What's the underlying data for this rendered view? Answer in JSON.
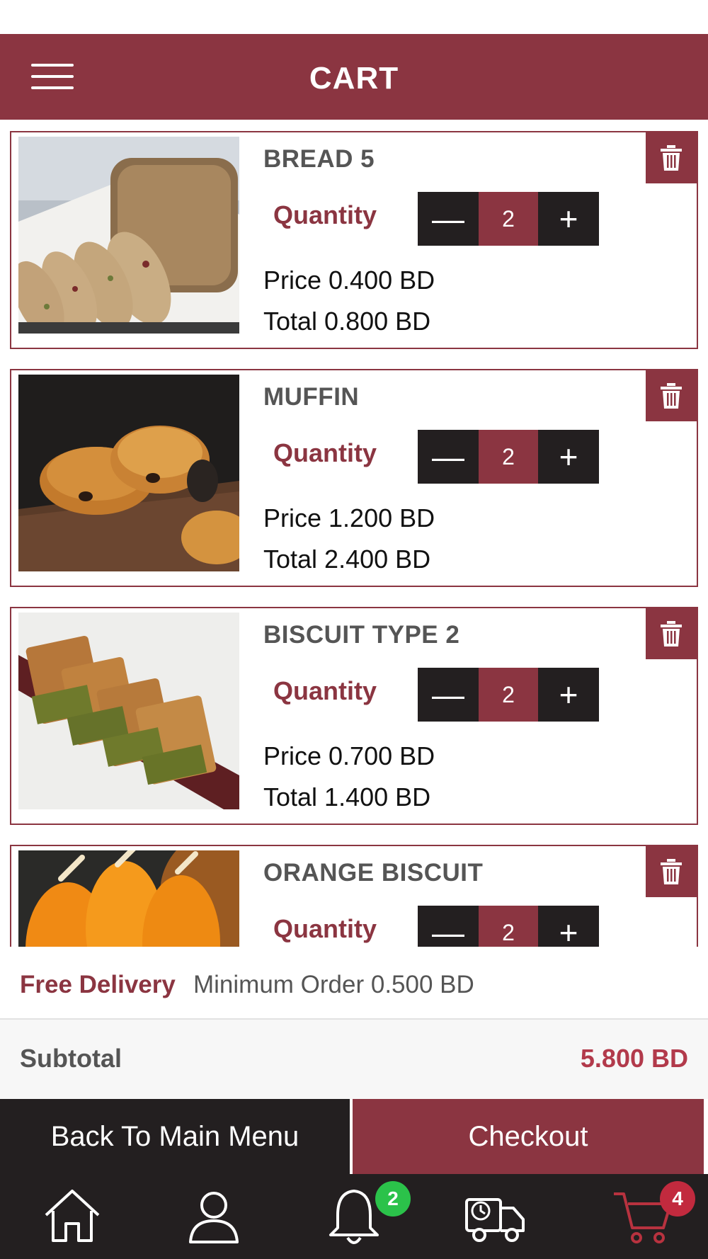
{
  "header": {
    "title": "CART"
  },
  "icons": {
    "menu": "hamburger-menu-icon",
    "delete": "trash-icon",
    "minus": "minus-icon",
    "plus": "plus-icon"
  },
  "colors": {
    "brand": "#8b3541",
    "dark": "#231f20",
    "subtotal_value": "#b23a4b",
    "badge_green": "#2bc24a",
    "badge_red": "#c22a3e"
  },
  "cart": {
    "items": [
      {
        "name": "BREAD 5",
        "quantity_label": "Quantity",
        "quantity": "2",
        "minus": "—",
        "plus": "+",
        "price": "Price 0.400 BD",
        "total": "Total 0.800 BD"
      },
      {
        "name": "MUFFIN",
        "quantity_label": "Quantity",
        "quantity": "2",
        "minus": "—",
        "plus": "+",
        "price": "Price 1.200 BD",
        "total": "Total 2.400 BD"
      },
      {
        "name": "BISCUIT TYPE 2",
        "quantity_label": "Quantity",
        "quantity": "2",
        "minus": "—",
        "plus": "+",
        "price": "Price 0.700 BD",
        "total": "Total 1.400 BD"
      },
      {
        "name": "ORANGE BISCUIT",
        "quantity_label": "Quantity",
        "quantity": "2",
        "minus": "—",
        "plus": "+",
        "price": "",
        "total": ""
      }
    ]
  },
  "delivery": {
    "free_label": "Free Delivery",
    "minimum_text": "Minimum Order 0.500 BD"
  },
  "subtotal": {
    "label": "Subtotal",
    "value": "5.800 BD"
  },
  "actions": {
    "back_label": "Back To Main Menu",
    "checkout_label": "Checkout"
  },
  "tabbar": {
    "tabs": [
      {
        "icon": "home-icon"
      },
      {
        "icon": "profile-icon"
      },
      {
        "icon": "notification-bell-icon",
        "badge": "2"
      },
      {
        "icon": "delivery-truck-icon"
      },
      {
        "icon": "cart-icon",
        "badge": "4"
      }
    ]
  }
}
